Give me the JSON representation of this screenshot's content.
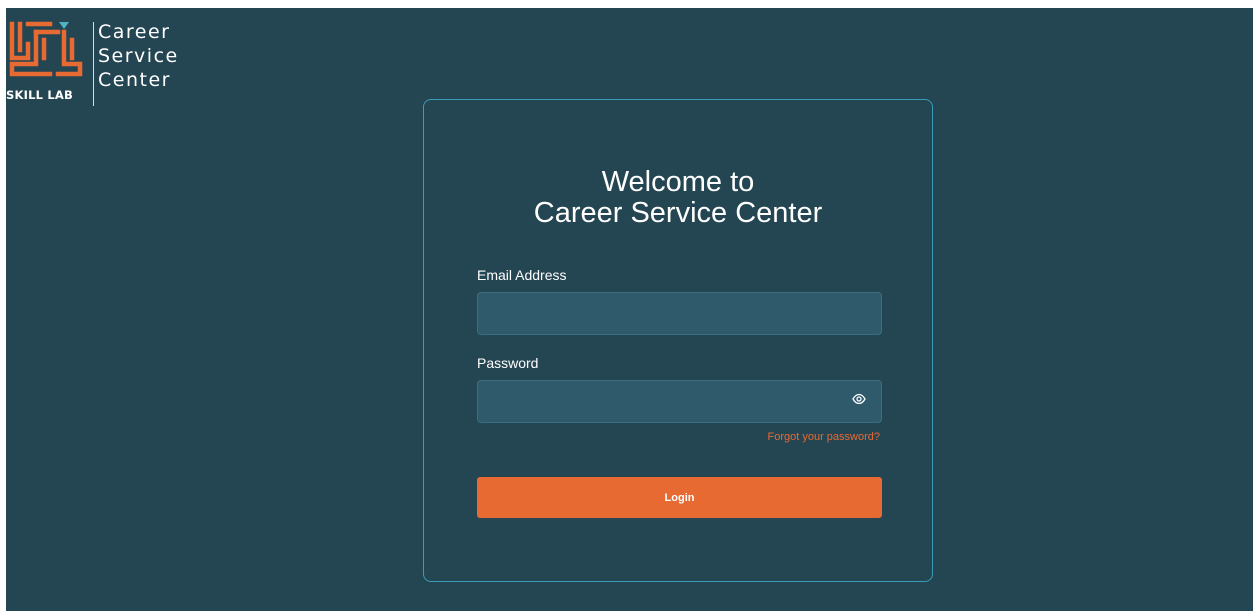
{
  "brand": {
    "logo_text": "SKILL LAB",
    "name_lines": [
      "Career",
      "Service",
      "Center"
    ],
    "colors": {
      "orange": "#e86a33",
      "teal": "#4fb3c0",
      "background": "#244552"
    }
  },
  "login": {
    "title_line1": "Welcome to",
    "title_line2": "Career Service Center",
    "email_label": "Email Address",
    "email_value": "",
    "password_label": "Password",
    "password_value": "",
    "password_toggle_icon": "eye-icon",
    "forgot_link": "Forgot your password?",
    "login_button": "Login"
  }
}
